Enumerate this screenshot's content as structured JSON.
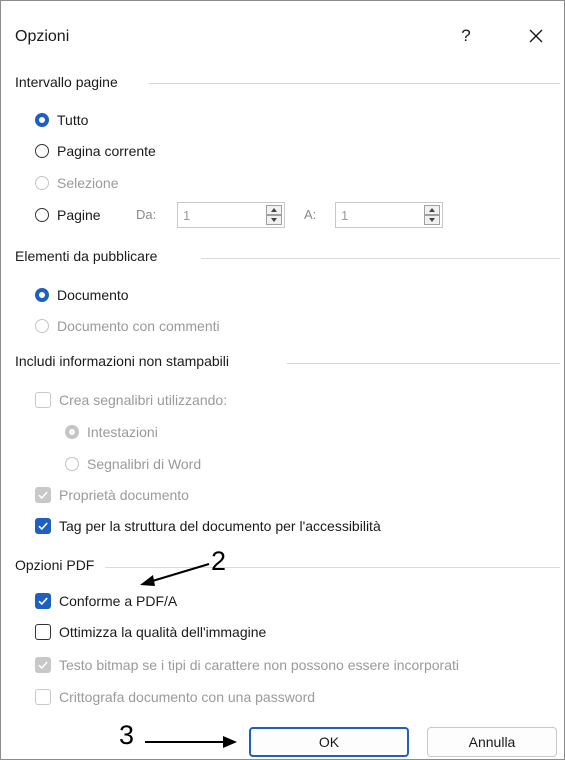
{
  "window": {
    "title": "Opzioni",
    "help_label": "?",
    "help_icon": "question-icon",
    "close_icon": "close-icon"
  },
  "page_range": {
    "label": "Intervallo pagine",
    "all": "Tutto",
    "current": "Pagina corrente",
    "selection": "Selezione",
    "pages": "Pagine",
    "from_label": "Da:",
    "from_value": "1",
    "to_label": "A:",
    "to_value": "1"
  },
  "publish": {
    "label": "Elementi da pubblicare",
    "document": "Documento",
    "document_comments": "Documento con commenti"
  },
  "nonprint": {
    "label": "Includi informazioni non stampabili",
    "create_bookmarks": "Crea segnalibri utilizzando:",
    "headings": "Intestazioni",
    "word_bookmarks": "Segnalibri di Word",
    "doc_properties": "Proprietà documento",
    "structure_tags": "Tag per la struttura del documento per l'accessibilità"
  },
  "pdf": {
    "label": "Opzioni PDF",
    "pdfa": "Conforme a PDF/A",
    "optimize_image": "Ottimizza la qualità dell'immagine",
    "bitmap_text": "Testo bitmap se i tipi di carattere non possono essere incorporati",
    "encrypt": "Crittografa documento con una password"
  },
  "buttons": {
    "ok": "OK",
    "cancel": "Annulla"
  },
  "annotations": {
    "num2": "2",
    "num3": "3"
  },
  "colors": {
    "accent": "#1f5fbf",
    "disabled": "#c4c4c4"
  }
}
